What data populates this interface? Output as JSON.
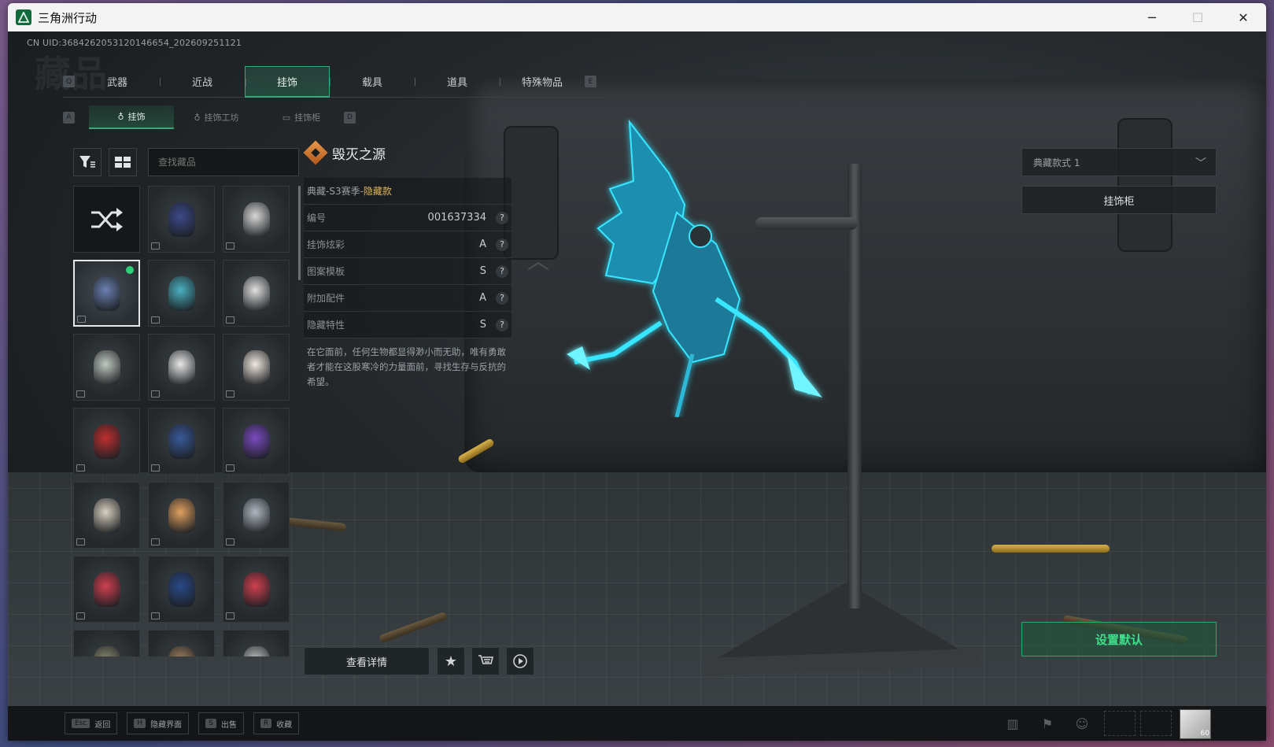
{
  "window": {
    "title": "三角洲行动",
    "minimize": "─",
    "maximize": "☐",
    "close": "✕"
  },
  "uid": "CN UID:3684262053120146654_202609251121",
  "watermark": "藏品",
  "main_tabs": {
    "left_key": "Q",
    "right_key": "E",
    "items": [
      {
        "label": "武器",
        "active": false
      },
      {
        "label": "近战",
        "active": false
      },
      {
        "label": "挂饰",
        "active": true
      },
      {
        "label": "载具",
        "active": false
      },
      {
        "label": "道具",
        "active": false
      },
      {
        "label": "特殊物品",
        "active": false
      }
    ]
  },
  "sub_tabs": {
    "left_key": "A",
    "right_key": "D",
    "items": [
      {
        "label": "挂饰",
        "active": true
      },
      {
        "label": "挂饰工坊",
        "active": false
      },
      {
        "label": "挂饰柜",
        "active": false
      }
    ]
  },
  "search": {
    "placeholder": "查找藏品"
  },
  "grid_items": [
    {
      "kind": "shuffle",
      "color": "#15181a",
      "selected": false
    },
    {
      "kind": "charm",
      "color": "#3b4a8a",
      "selected": false
    },
    {
      "kind": "charm",
      "color": "#d8d8d8",
      "selected": false
    },
    {
      "kind": "charm",
      "color": "#6a80b0",
      "selected": true,
      "equipped": true
    },
    {
      "kind": "charm",
      "color": "#4ab0c0",
      "selected": false
    },
    {
      "kind": "charm",
      "color": "#e0e0e0",
      "selected": false
    },
    {
      "kind": "charm",
      "color": "#c0c8c0",
      "selected": false
    },
    {
      "kind": "charm",
      "color": "#e8e8e8",
      "selected": false
    },
    {
      "kind": "charm",
      "color": "#f0e8e0",
      "selected": false
    },
    {
      "kind": "charm",
      "color": "#c03030",
      "selected": false
    },
    {
      "kind": "charm",
      "color": "#3a5a9a",
      "selected": false
    },
    {
      "kind": "charm",
      "color": "#7a4ac0",
      "selected": false
    },
    {
      "kind": "charm",
      "color": "#d8d0c0",
      "selected": false
    },
    {
      "kind": "charm",
      "color": "#e0a060",
      "selected": false
    },
    {
      "kind": "charm",
      "color": "#b0b8c0",
      "selected": false
    },
    {
      "kind": "charm",
      "color": "#d04050",
      "selected": false
    },
    {
      "kind": "charm",
      "color": "#2a4a8a",
      "selected": false
    },
    {
      "kind": "charm",
      "color": "#d04050",
      "selected": false
    },
    {
      "kind": "charm",
      "color": "#8a8a70",
      "selected": false
    },
    {
      "kind": "charm",
      "color": "#a08060",
      "selected": false
    },
    {
      "kind": "charm",
      "color": "#c0c0c0",
      "selected": false
    }
  ],
  "item": {
    "name": "毁灭之源",
    "season": "典藏-S3赛季-",
    "season_tag": "隐藏款",
    "rows": [
      {
        "label": "编号",
        "value": "001637334"
      },
      {
        "label": "挂饰炫彩",
        "value": "A"
      },
      {
        "label": "图案模板",
        "value": "S"
      },
      {
        "label": "附加配件",
        "value": "A"
      },
      {
        "label": "隐藏特性",
        "value": "S"
      }
    ],
    "help": "?",
    "description": "在它面前，任何生物都显得渺小而无助，唯有勇敢者才能在这股寒冷的力量面前，寻找生存与反抗的希望。"
  },
  "actions": {
    "details": "查看详情",
    "favorite_icon": "star-icon",
    "cart_icon": "cart-icon",
    "play_icon": "play-icon"
  },
  "right_panel": {
    "style_select": "典藏款式 1",
    "charm_cabinet": "挂饰柜",
    "set_default": "设置默认"
  },
  "bottom_hints": [
    {
      "key": "Esc",
      "label": "返回"
    },
    {
      "key": "H",
      "label": "隐藏界面"
    },
    {
      "key": "S",
      "label": "出售"
    },
    {
      "key": "R",
      "label": "收藏"
    }
  ],
  "avatar_level": "60",
  "colors": {
    "accent": "#2fa86a",
    "accent_text": "#3fe08a",
    "hidden_tag": "#e0b45a",
    "charm_glow": "#39e6ff"
  }
}
